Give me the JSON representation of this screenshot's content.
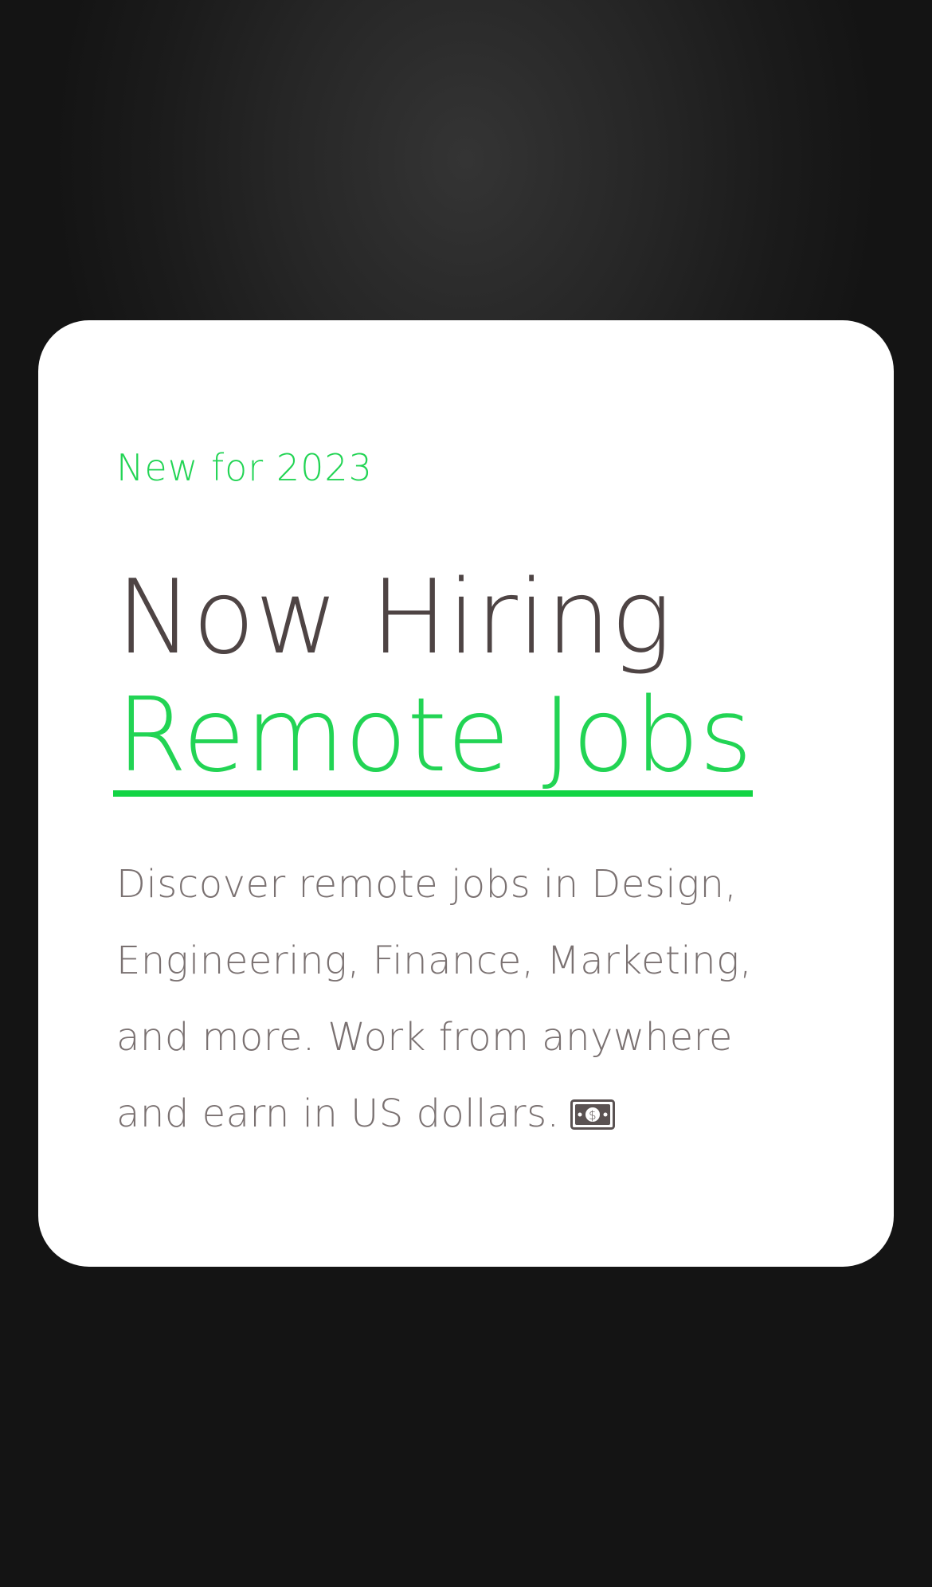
{
  "card": {
    "eyebrow": "New for 2023",
    "headline_line1": "Now Hiring",
    "headline_line2": "Remote Jobs",
    "description": "Discover remote jobs in Design, Engineering, Finance, Marketing, and more. Work from anywhere and earn in US dollars.",
    "description_icon": "dollar-banknote-icon"
  },
  "colors": {
    "accent": "#22d454",
    "headline": "#4e4444",
    "body_text": "#7a7171",
    "card_background": "#ffffff",
    "page_background": "#1b1b1b"
  }
}
